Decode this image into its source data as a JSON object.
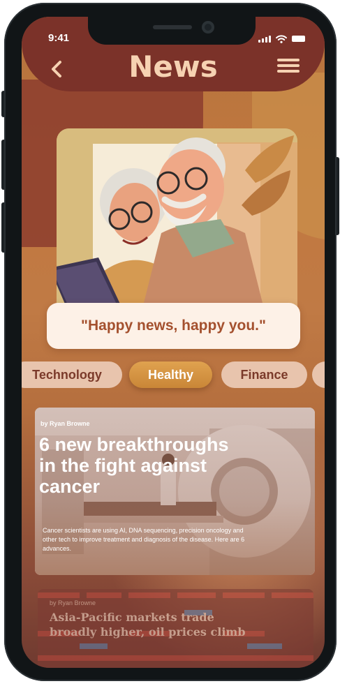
{
  "status_bar": {
    "time": "9:41"
  },
  "header": {
    "title": "News",
    "back_icon": "chevron-left-icon",
    "menu_icon": "hamburger-menu-icon"
  },
  "hero": {
    "quote": "\"Happy news, happy you.\""
  },
  "categories": [
    {
      "label": "Technology",
      "active": false
    },
    {
      "label": "Healthy",
      "active": true
    },
    {
      "label": "Finance",
      "active": false
    },
    {
      "label": "",
      "active": false
    }
  ],
  "articles": [
    {
      "byline": "by Ryan Browne",
      "headline": "6 new breakthroughs in the fight against cancer",
      "summary": "Cancer scientists are using AI, DNA sequencing, precision oncology and other tech to improve treatment and diagnosis of the disease. Here are 6 advances."
    },
    {
      "byline": "by Ryan Browne",
      "headline": "Asia-Pacific markets trade broadly higher, oil prices climb"
    }
  ],
  "colors": {
    "header": "#7b3229",
    "title": "#f6d2b2",
    "accent": "#d9963f",
    "chip": "#e8c4ad"
  }
}
